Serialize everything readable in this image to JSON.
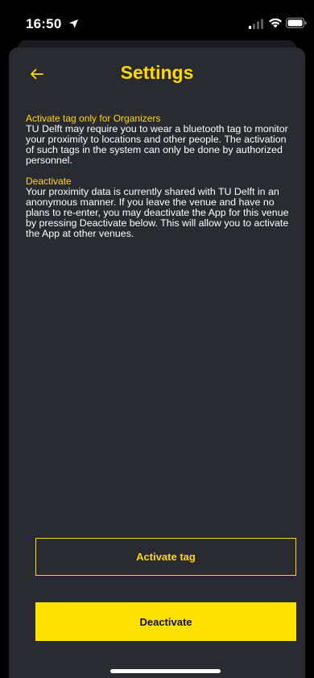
{
  "status_bar": {
    "time": "16:50",
    "icons": [
      "location-arrow-icon",
      "signal-icon",
      "wifi-icon",
      "battery-icon"
    ]
  },
  "header": {
    "back_icon": "arrow-left-icon",
    "title": "Settings"
  },
  "sections": [
    {
      "title": "Activate tag only for Organizers",
      "body": "TU Delft may require you to wear a bluetooth tag to monitor your proximity to locations and other people. The activation of such tags in the system can only be done by authorized personnel."
    },
    {
      "title": "Deactivate",
      "body": "Your proximity data is currently shared with TU Delft in an anonymous manner. If you leave the venue and have no plans to re-enter, you may deactivate the App for this venue by pressing Deactivate below. This will allow you to activate the App at other venues."
    }
  ],
  "buttons": {
    "activate_tag": "Activate tag",
    "deactivate": "Deactivate"
  },
  "colors": {
    "accent": "#ffd900",
    "background": "#2a2b31",
    "primary_button": "#ffe100"
  }
}
